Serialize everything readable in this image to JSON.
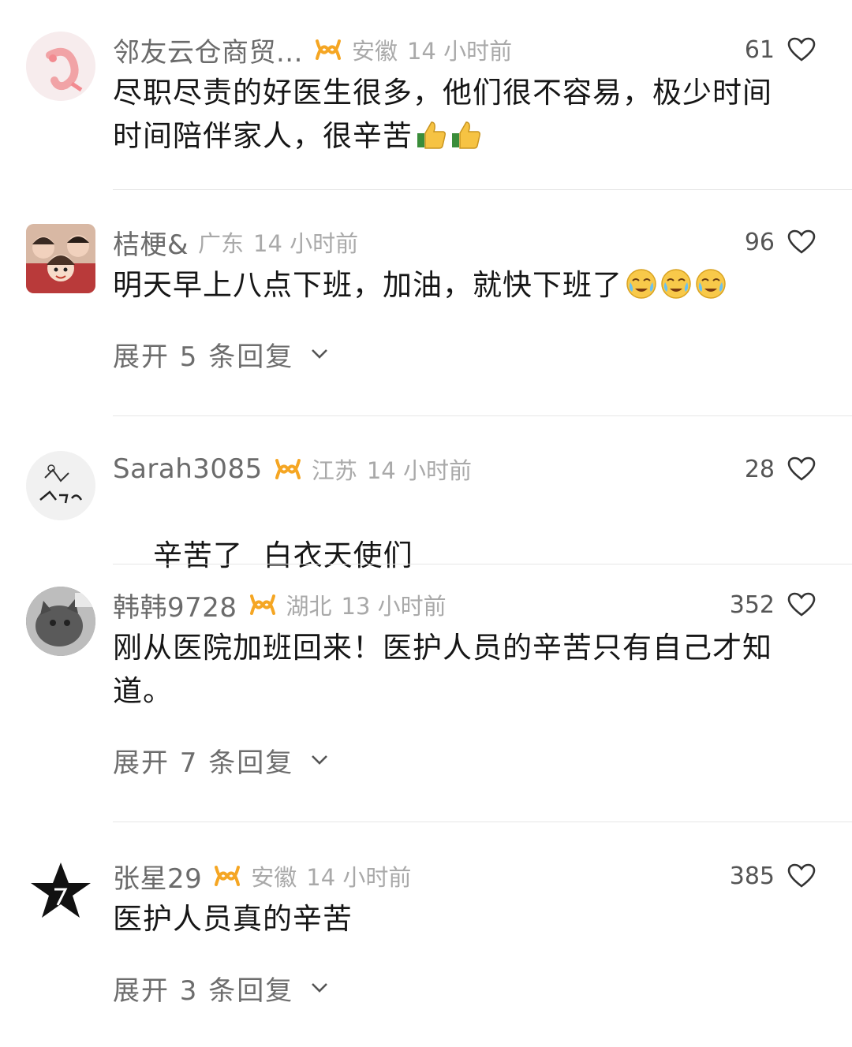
{
  "comments": [
    {
      "username": "邻友云仓商贸...",
      "location": "安徽",
      "time": "14 小时前",
      "likes": "61",
      "text": "尽职尽责的好医生很多，他们很不容易，极少时间时间陪伴家人，很辛苦",
      "emoji": [
        "thumbs-up",
        "thumbs-up"
      ],
      "avatar": "shrimp-avatar"
    },
    {
      "username": "桔梗&",
      "location": "广东",
      "time": "14 小时前",
      "likes": "96",
      "text": "明天早上八点下班，加油，就快下班了",
      "emoji": [
        "crying-face",
        "crying-face",
        "crying-face"
      ],
      "expand": "展开 5 条回复",
      "avatar": "family-photo-avatar"
    },
    {
      "username": "Sarah3085",
      "location": "江苏",
      "time": "14 小时前",
      "likes": "28",
      "text": "辛苦了  白衣天使们",
      "avatar": "sketch-avatar"
    },
    {
      "username": "韩韩9728",
      "location": "湖北",
      "time": "13 小时前",
      "likes": "352",
      "text": "刚从医院加班回来！医护人员的辛苦只有自己才知道。",
      "expand": "展开 7 条回复",
      "avatar": "cat-photo-avatar"
    },
    {
      "username": "张星29",
      "location": "安徽",
      "time": "14 小时前",
      "likes": "385",
      "text": "医护人员真的辛苦",
      "expand": "展开 3 条回复",
      "avatar": "star-avatar"
    }
  ],
  "colors": {
    "badge": "#f5a623",
    "username": "#6b6b6b",
    "meta": "#a9a9a9"
  }
}
